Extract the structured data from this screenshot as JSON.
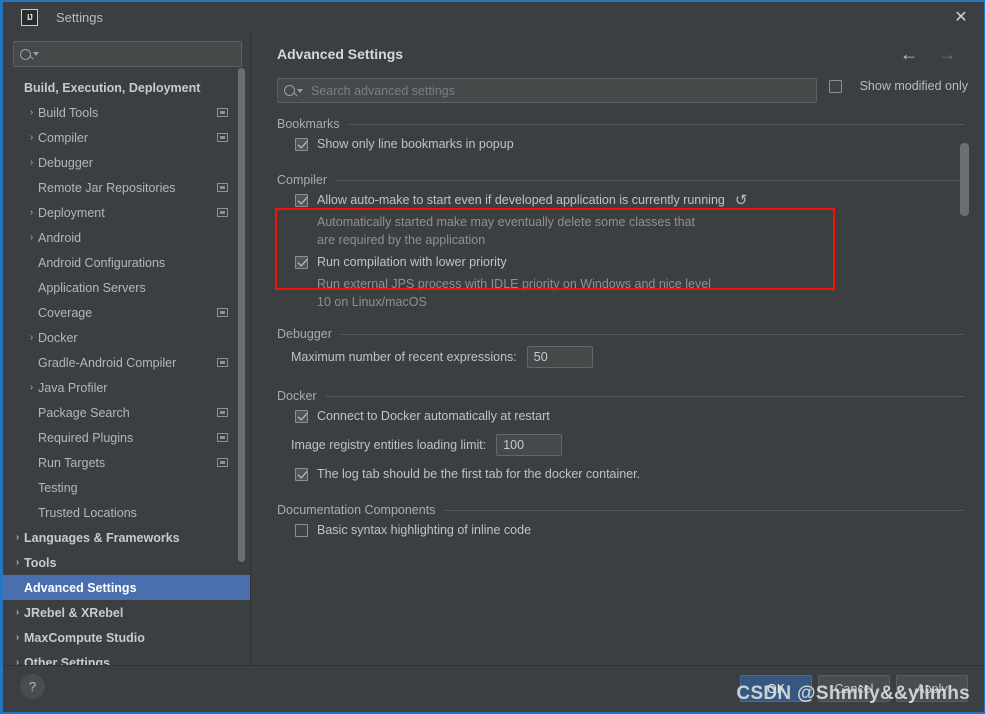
{
  "window": {
    "title": "Settings",
    "logo_text": "IJ",
    "close_icon": "✕",
    "accent_color": "#2675bf",
    "selection_color": "#4b6eaf",
    "highlight_color": "#fa0f06"
  },
  "sidebar": {
    "search_placeholder": "",
    "items": [
      {
        "label": "Build, Execution, Deployment",
        "indent": 0,
        "arrow": "",
        "bold": true,
        "mod": false,
        "selected": false
      },
      {
        "label": "Build Tools",
        "indent": 1,
        "arrow": "›",
        "bold": false,
        "mod": true,
        "selected": false
      },
      {
        "label": "Compiler",
        "indent": 1,
        "arrow": "›",
        "bold": false,
        "mod": true,
        "selected": false
      },
      {
        "label": "Debugger",
        "indent": 1,
        "arrow": "›",
        "bold": false,
        "mod": false,
        "selected": false
      },
      {
        "label": "Remote Jar Repositories",
        "indent": 1,
        "arrow": "",
        "bold": false,
        "mod": true,
        "selected": false
      },
      {
        "label": "Deployment",
        "indent": 1,
        "arrow": "›",
        "bold": false,
        "mod": true,
        "selected": false
      },
      {
        "label": "Android",
        "indent": 1,
        "arrow": "›",
        "bold": false,
        "mod": false,
        "selected": false
      },
      {
        "label": "Android Configurations",
        "indent": 1,
        "arrow": "",
        "bold": false,
        "mod": false,
        "selected": false
      },
      {
        "label": "Application Servers",
        "indent": 1,
        "arrow": "",
        "bold": false,
        "mod": false,
        "selected": false
      },
      {
        "label": "Coverage",
        "indent": 1,
        "arrow": "",
        "bold": false,
        "mod": true,
        "selected": false
      },
      {
        "label": "Docker",
        "indent": 1,
        "arrow": "›",
        "bold": false,
        "mod": false,
        "selected": false
      },
      {
        "label": "Gradle-Android Compiler",
        "indent": 1,
        "arrow": "",
        "bold": false,
        "mod": true,
        "selected": false
      },
      {
        "label": "Java Profiler",
        "indent": 1,
        "arrow": "›",
        "bold": false,
        "mod": false,
        "selected": false
      },
      {
        "label": "Package Search",
        "indent": 1,
        "arrow": "",
        "bold": false,
        "mod": true,
        "selected": false
      },
      {
        "label": "Required Plugins",
        "indent": 1,
        "arrow": "",
        "bold": false,
        "mod": true,
        "selected": false
      },
      {
        "label": "Run Targets",
        "indent": 1,
        "arrow": "",
        "bold": false,
        "mod": true,
        "selected": false
      },
      {
        "label": "Testing",
        "indent": 1,
        "arrow": "",
        "bold": false,
        "mod": false,
        "selected": false
      },
      {
        "label": "Trusted Locations",
        "indent": 1,
        "arrow": "",
        "bold": false,
        "mod": false,
        "selected": false
      },
      {
        "label": "Languages & Frameworks",
        "indent": 0,
        "arrow": "›",
        "bold": true,
        "mod": false,
        "selected": false
      },
      {
        "label": "Tools",
        "indent": 0,
        "arrow": "›",
        "bold": true,
        "mod": false,
        "selected": false
      },
      {
        "label": "Advanced Settings",
        "indent": 0,
        "arrow": "",
        "bold": true,
        "mod": false,
        "selected": true
      },
      {
        "label": "JRebel & XRebel",
        "indent": 0,
        "arrow": "›",
        "bold": true,
        "mod": false,
        "selected": false
      },
      {
        "label": "MaxCompute Studio",
        "indent": 0,
        "arrow": "›",
        "bold": true,
        "mod": false,
        "selected": false
      },
      {
        "label": "Other Settings",
        "indent": 0,
        "arrow": "›",
        "bold": true,
        "mod": false,
        "selected": false
      }
    ]
  },
  "main": {
    "title": "Advanced Settings",
    "search_placeholder": "Search advanced settings",
    "search_value": "",
    "back_arrow": "←",
    "forward_arrow": "→",
    "show_modified_label": "Show modified only",
    "show_modified_checked": false,
    "sections": [
      {
        "title": "Bookmarks",
        "rows": [
          {
            "kind": "checkbox",
            "label": "Show only line bookmarks in popup",
            "checked": true,
            "revert": false,
            "desc": ""
          }
        ]
      },
      {
        "title": "Compiler",
        "rows": [
          {
            "kind": "checkbox",
            "label": "Allow auto-make to start even if developed application is currently running",
            "checked": true,
            "revert": true,
            "desc": "Automatically started make may eventually delete some classes that\nare required by the application"
          },
          {
            "kind": "checkbox",
            "label": "Run compilation with lower priority",
            "checked": true,
            "revert": false,
            "desc": "Run external JPS process with IDLE priority on Windows and nice level\n10 on Linux/macOS"
          }
        ]
      },
      {
        "title": "Debugger",
        "rows": [
          {
            "kind": "field",
            "label": "Maximum number of recent expressions:",
            "value": "50"
          }
        ]
      },
      {
        "title": "Docker",
        "rows": [
          {
            "kind": "checkbox",
            "label": "Connect to Docker automatically at restart",
            "checked": true,
            "revert": false,
            "desc": ""
          },
          {
            "kind": "field",
            "label": "Image registry entities loading limit:",
            "value": "100"
          },
          {
            "kind": "checkbox",
            "label": "The log tab should be the first tab for the docker container.",
            "checked": true,
            "revert": false,
            "desc": ""
          }
        ]
      },
      {
        "title": "Documentation Components",
        "rows": [
          {
            "kind": "checkbox",
            "label": "Basic syntax highlighting of inline code",
            "checked": false,
            "revert": false,
            "desc": ""
          }
        ]
      }
    ]
  },
  "footer": {
    "help_icon": "?",
    "buttons": [
      {
        "label": "OK",
        "style": "primary"
      },
      {
        "label": "Cancel",
        "style": "normal"
      },
      {
        "label": "Apply",
        "style": "normal"
      }
    ]
  },
  "watermark": {
    "text": "CSDN @Shmily&&ylimhs"
  },
  "icons": {
    "search": "search-icon",
    "revert": "↺",
    "chevron_right": "›"
  }
}
